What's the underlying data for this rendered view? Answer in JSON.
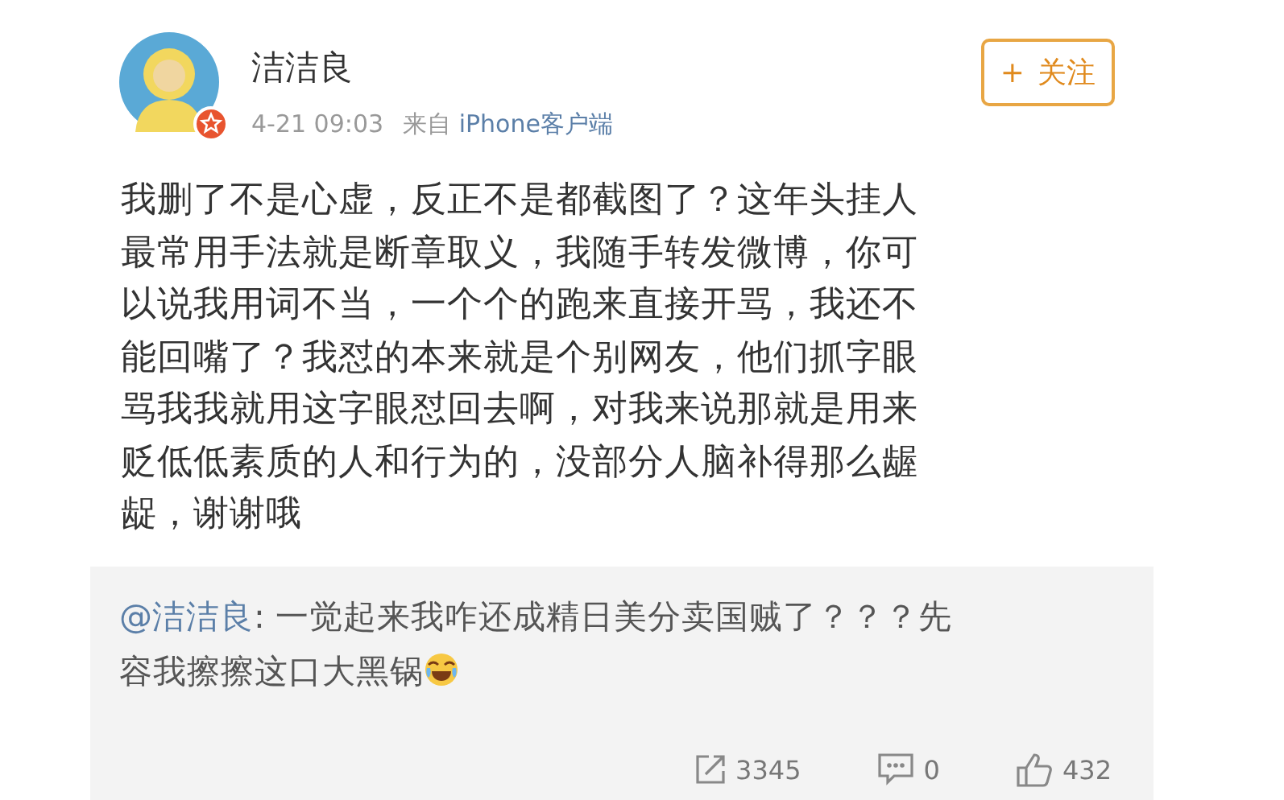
{
  "author": {
    "name": "洁洁良",
    "verified": true
  },
  "meta": {
    "time": "4-21 09:03",
    "source_prefix": "来自",
    "source": "iPhone客户端"
  },
  "follow_button": {
    "icon": "+",
    "label": "关注"
  },
  "post_text": "我删了不是心虚，反正不是都截图了？这年头挂人最常用手法就是断章取义，我随手转发微博，你可以说我用词不当，一个个的跑来直接开骂，我还不能回嘴了？我怼的本来就是个别网友，他们抓字眼骂我我就用这字眼怼回去啊，对我来说那就是用来贬低低素质的人和行为的，没部分人脑补得那么龌龊，谢谢哦",
  "repost": {
    "mention": "@洁洁良",
    "text": ": 一觉起来我咋还成精日美分卖国贼了？？？先容我擦擦这口大黑锅"
  },
  "actions": [
    {
      "kind": "repost",
      "count": "3345"
    },
    {
      "kind": "comment",
      "count": "0"
    },
    {
      "kind": "like",
      "count": "432"
    }
  ]
}
